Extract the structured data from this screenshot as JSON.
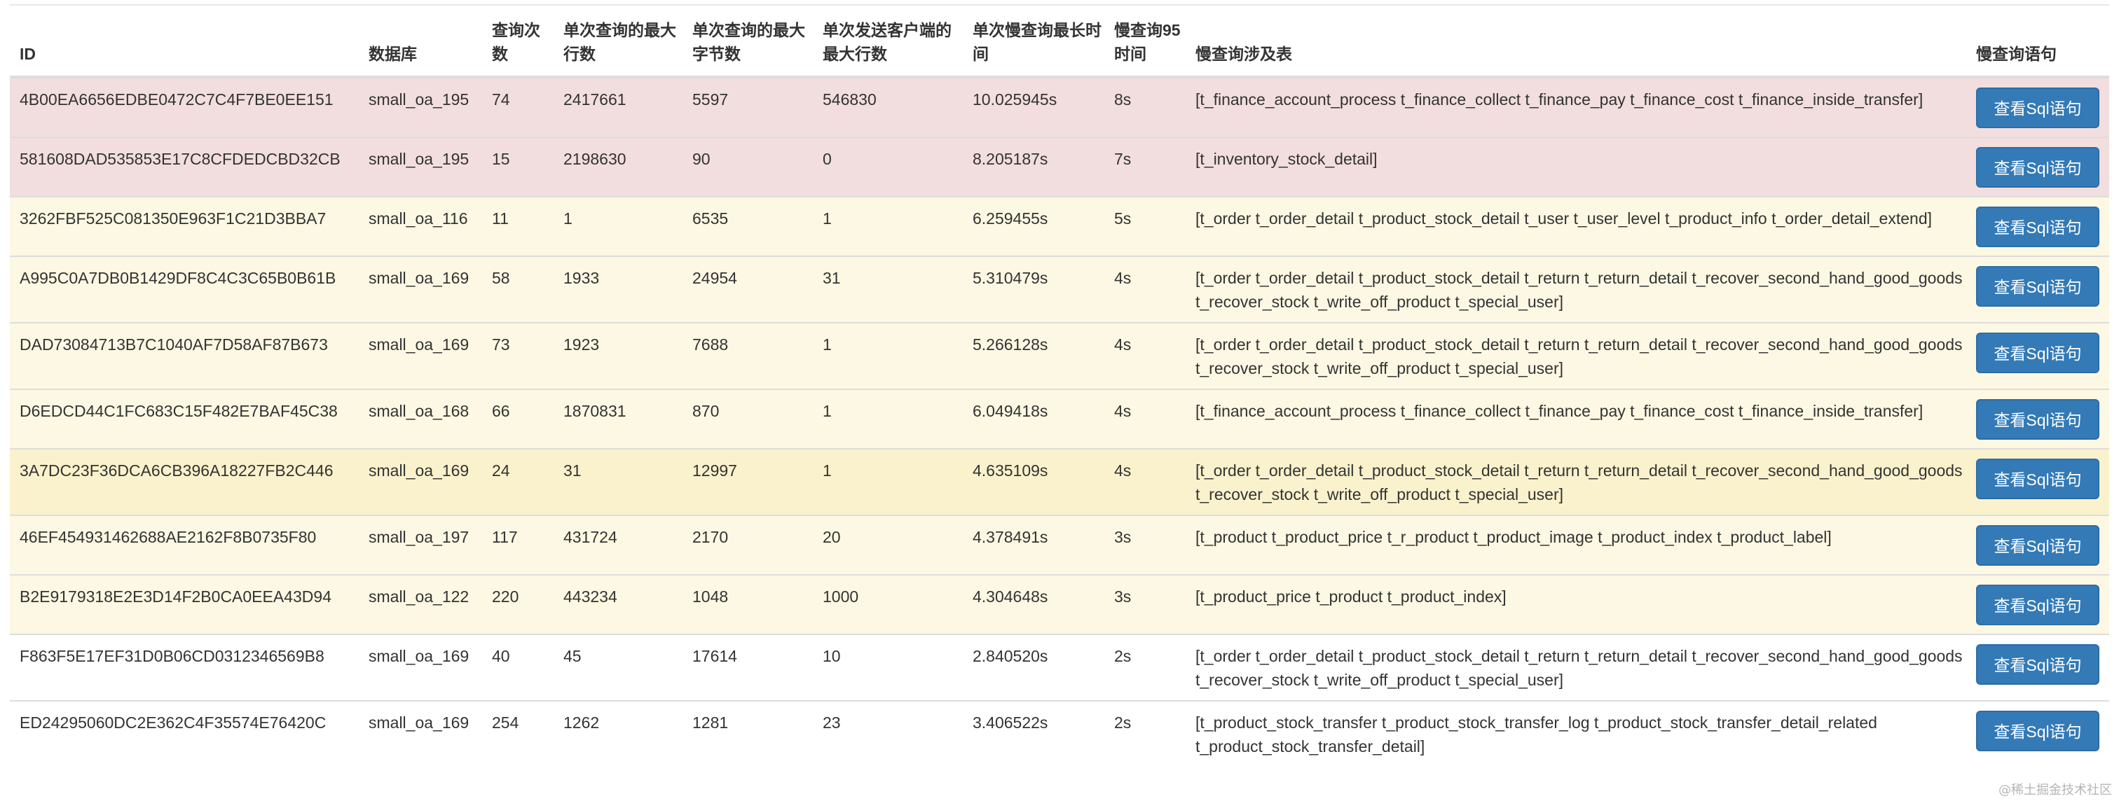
{
  "table": {
    "headers": {
      "id": "ID",
      "db": "数据库",
      "count": "查询次数",
      "max_rows": "单次查询的最大行数",
      "max_bytes": "单次查询的最大字节数",
      "max_sent": "单次发送客户端的最大行数",
      "max_time": "单次慢查询最长时间",
      "p95": "慢查询95时间",
      "tables": "慢查询涉及表",
      "sql": "慢查询语句"
    },
    "button_label": "查看Sql语句",
    "rows": [
      {
        "id": "4B00EA6656EDBE0472C7C4F7BE0EE151",
        "db": "small_oa_195",
        "count": "74",
        "max_rows": "2417661",
        "max_bytes": "5597",
        "max_sent": "546830",
        "max_time": "10.025945s",
        "p95": "8s",
        "tables": "[t_finance_account_process t_finance_collect t_finance_pay t_finance_cost t_finance_inside_transfer]",
        "style": "danger"
      },
      {
        "id": "581608DAD535853E17C8CFDEDCBD32CB",
        "db": "small_oa_195",
        "count": "15",
        "max_rows": "2198630",
        "max_bytes": "90",
        "max_sent": "0",
        "max_time": "8.205187s",
        "p95": "7s",
        "tables": "[t_inventory_stock_detail]",
        "style": "danger"
      },
      {
        "id": "3262FBF525C081350E963F1C21D3BBA7",
        "db": "small_oa_116",
        "count": "11",
        "max_rows": "1",
        "max_bytes": "6535",
        "max_sent": "1",
        "max_time": "6.259455s",
        "p95": "5s",
        "tables": "[t_order t_order_detail t_product_stock_detail t_user t_user_level t_product_info t_order_detail_extend]",
        "style": "warning"
      },
      {
        "id": "A995C0A7DB0B1429DF8C4C3C65B0B61B",
        "db": "small_oa_169",
        "count": "58",
        "max_rows": "1933",
        "max_bytes": "24954",
        "max_sent": "31",
        "max_time": "5.310479s",
        "p95": "4s",
        "tables": "[t_order t_order_detail t_product_stock_detail t_return t_return_detail t_recover_second_hand_good_goods t_recover_stock t_write_off_product t_special_user]",
        "style": "warning"
      },
      {
        "id": "DAD73084713B7C1040AF7D58AF87B673",
        "db": "small_oa_169",
        "count": "73",
        "max_rows": "1923",
        "max_bytes": "7688",
        "max_sent": "1",
        "max_time": "5.266128s",
        "p95": "4s",
        "tables": "[t_order t_order_detail t_product_stock_detail t_return t_return_detail t_recover_second_hand_good_goods t_recover_stock t_write_off_product t_special_user]",
        "style": "warning"
      },
      {
        "id": "D6EDCD44C1FC683C15F482E7BAF45C38",
        "db": "small_oa_168",
        "count": "66",
        "max_rows": "1870831",
        "max_bytes": "870",
        "max_sent": "1",
        "max_time": "6.049418s",
        "p95": "4s",
        "tables": "[t_finance_account_process t_finance_collect t_finance_pay t_finance_cost t_finance_inside_transfer]",
        "style": "warning"
      },
      {
        "id": "3A7DC23F36DCA6CB396A18227FB2C446",
        "db": "small_oa_169",
        "count": "24",
        "max_rows": "31",
        "max_bytes": "12997",
        "max_sent": "1",
        "max_time": "4.635109s",
        "p95": "4s",
        "tables": "[t_order t_order_detail t_product_stock_detail t_return t_return_detail t_recover_second_hand_good_goods t_recover_stock t_write_off_product t_special_user]",
        "style": "warning-hover"
      },
      {
        "id": "46EF454931462688AE2162F8B0735F80",
        "db": "small_oa_197",
        "count": "117",
        "max_rows": "431724",
        "max_bytes": "2170",
        "max_sent": "20",
        "max_time": "4.378491s",
        "p95": "3s",
        "tables": "[t_product t_product_price t_r_product t_product_image t_product_index t_product_label]",
        "style": "warning"
      },
      {
        "id": "B2E9179318E2E3D14F2B0CA0EEA43D94",
        "db": "small_oa_122",
        "count": "220",
        "max_rows": "443234",
        "max_bytes": "1048",
        "max_sent": "1000",
        "max_time": "4.304648s",
        "p95": "3s",
        "tables": "[t_product_price t_product t_product_index]",
        "style": "warning"
      },
      {
        "id": "F863F5E17EF31D0B06CD0312346569B8",
        "db": "small_oa_169",
        "count": "40",
        "max_rows": "45",
        "max_bytes": "17614",
        "max_sent": "10",
        "max_time": "2.840520s",
        "p95": "2s",
        "tables": "[t_order t_order_detail t_product_stock_detail t_return t_return_detail t_recover_second_hand_good_goods t_recover_stock t_write_off_product t_special_user]",
        "style": "plain"
      },
      {
        "id": "ED24295060DC2E362C4F35574E76420C",
        "db": "small_oa_169",
        "count": "254",
        "max_rows": "1262",
        "max_bytes": "1281",
        "max_sent": "23",
        "max_time": "3.406522s",
        "p95": "2s",
        "tables": "[t_product_stock_transfer t_product_stock_transfer_log t_product_stock_transfer_detail_related t_product_stock_transfer_detail]",
        "style": "plain"
      }
    ]
  },
  "watermark": "@稀土掘金技术社区"
}
